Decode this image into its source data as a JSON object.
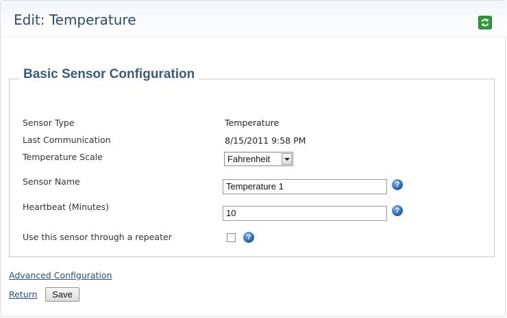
{
  "header": {
    "title": "Edit: Temperature",
    "refresh_icon": "refresh-icon",
    "accent_color": "#2f9a3c"
  },
  "section": {
    "legend": "Basic Sensor Configuration"
  },
  "fields": {
    "sensor_type": {
      "label": "Sensor Type",
      "value": "Temperature"
    },
    "last_communication": {
      "label": "Last Communication",
      "value": "8/15/2011 9:58 PM"
    },
    "temperature_scale": {
      "label": "Temperature Scale",
      "selected": "Fahrenheit"
    },
    "sensor_name": {
      "label": "Sensor Name",
      "value": "Temperature 1"
    },
    "heartbeat": {
      "label": "Heartbeat (Minutes)",
      "value": "10"
    },
    "repeater": {
      "label": "Use this sensor through a repeater",
      "checked": false
    }
  },
  "help_icon_glyph": "?",
  "links": {
    "advanced": "Advanced Configuration",
    "return": "Return"
  },
  "buttons": {
    "save": "Save"
  }
}
